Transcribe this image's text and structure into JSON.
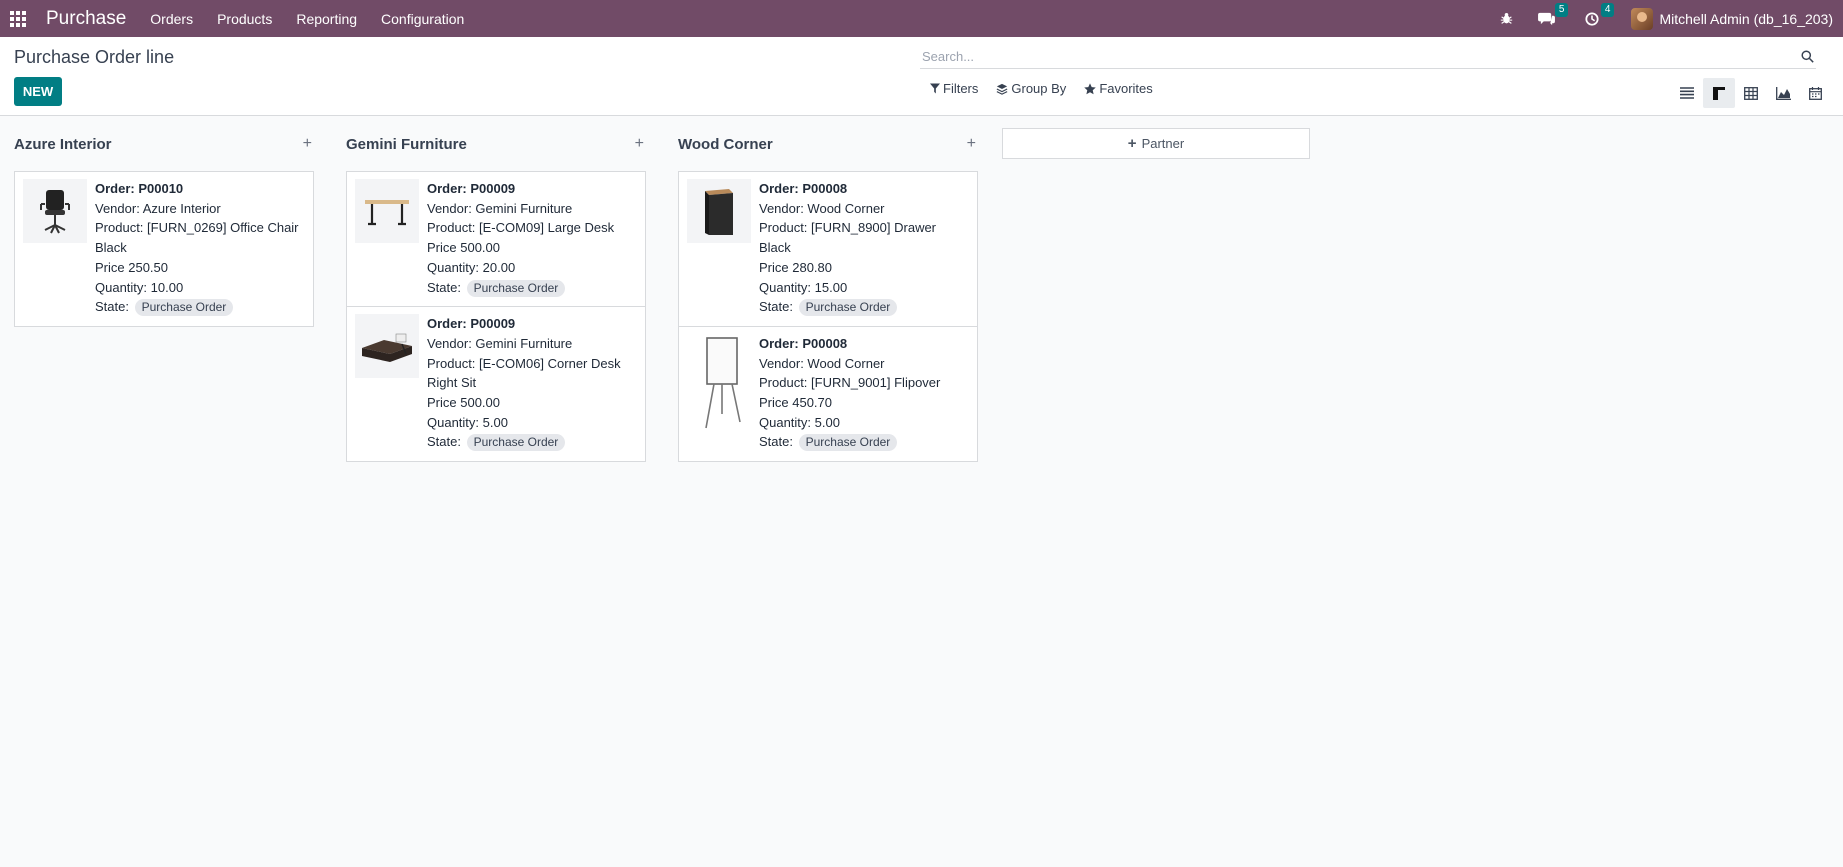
{
  "navbar": {
    "app_name": "Purchase",
    "menu": [
      "Orders",
      "Products",
      "Reporting",
      "Configuration"
    ],
    "messages_count": "5",
    "activities_count": "4",
    "user": "Mitchell Admin (db_16_203)"
  },
  "control_panel": {
    "title": "Purchase Order line",
    "new_label": "NEW",
    "search_placeholder": "Search...",
    "filters_label": "Filters",
    "group_by_label": "Group By",
    "favorites_label": "Favorites"
  },
  "kanban": {
    "columns": [
      {
        "title": "Azure Interior",
        "cards": [
          {
            "order": "Order: P00010",
            "vendor": "Vendor: Azure Interior",
            "product": "Product: [FURN_0269] Office Chair Black",
            "price": "Price 250.50",
            "quantity": "Quantity: 10.00",
            "state_label": "State:",
            "state": "Purchase Order",
            "image": "office-chair-image"
          }
        ]
      },
      {
        "title": "Gemini Furniture",
        "cards": [
          {
            "order": "Order: P00009",
            "vendor": "Vendor: Gemini Furniture",
            "product": "Product: [E-COM09] Large Desk",
            "price": "Price 500.00",
            "quantity": "Quantity: 20.00",
            "state_label": "State:",
            "state": "Purchase Order",
            "image": "large-desk-image"
          },
          {
            "order": "Order: P00009",
            "vendor": "Vendor: Gemini Furniture",
            "product": "Product: [E-COM06] Corner Desk Right Sit",
            "price": "Price 500.00",
            "quantity": "Quantity: 5.00",
            "state_label": "State:",
            "state": "Purchase Order",
            "image": "corner-desk-image"
          }
        ]
      },
      {
        "title": "Wood Corner",
        "cards": [
          {
            "order": "Order: P00008",
            "vendor": "Vendor: Wood Corner",
            "product": "Product: [FURN_8900] Drawer Black",
            "price": "Price 280.80",
            "quantity": "Quantity: 15.00",
            "state_label": "State:",
            "state": "Purchase Order",
            "image": "drawer-image"
          },
          {
            "order": "Order: P00008",
            "vendor": "Vendor: Wood Corner",
            "product": "Product: [FURN_9001] Flipover",
            "price": "Price 450.70",
            "quantity": "Quantity: 5.00",
            "state_label": "State:",
            "state": "Purchase Order",
            "image": "flipover-image"
          }
        ]
      }
    ],
    "add_column_label": "Partner"
  },
  "colors": {
    "navbar": "#714b67",
    "primary": "#017e84"
  }
}
